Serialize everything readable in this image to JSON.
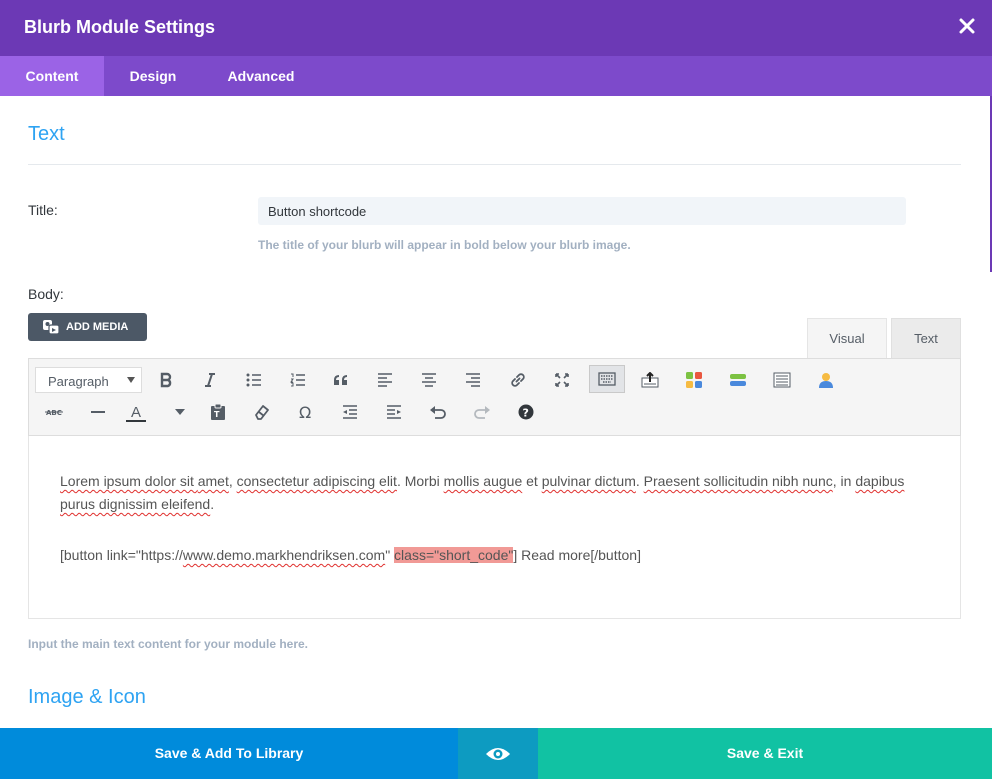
{
  "modal": {
    "title": "Blurb Module Settings"
  },
  "tabs": [
    {
      "label": "Content"
    },
    {
      "label": "Design"
    },
    {
      "label": "Advanced"
    }
  ],
  "sections": {
    "text": "Text",
    "image_icon": "Image & Icon"
  },
  "title_field": {
    "label": "Title:",
    "value": "Button shortcode",
    "help": "The title of your blurb will appear in bold below your blurb image."
  },
  "body_field": {
    "label": "Body:",
    "add_media": "ADD MEDIA",
    "tab_visual": "Visual",
    "tab_text": "Text",
    "format_select": "Paragraph",
    "help": "Input the main text content for your module here."
  },
  "editor_content": {
    "p1_a": "Lorem ipsum dolor sit ",
    "p1_b": "amet",
    "p1_c": ", ",
    "p1_d": "consectetur adipiscing elit",
    "p1_e": ". Morbi ",
    "p1_f": "mollis augue",
    "p1_g": " et ",
    "p1_h": "pulvinar dictum",
    "p1_i": ". ",
    "p1_j": "Praesent sollicitudin nibh nunc",
    "p1_k": ", in ",
    "p1_l": "dapibus purus dignissim eleifend",
    "p1_m": ".",
    "p2_a": "[button link=\"https://",
    "p2_b": "www.demo.markhendriksen.com",
    "p2_c": "\" ",
    "p2_d": "class=\"short_code\"",
    "p2_e": "] Read more[/button]"
  },
  "footer": {
    "save_library": "Save & Add To Library",
    "save_exit": "Save & Exit"
  },
  "colors": {
    "header": "#6c39b5",
    "tabbar": "#7d4acb",
    "active_tab": "#9b63e6",
    "accent_blue": "#2ea3f2",
    "save_library": "#008bdb",
    "preview": "#0d9bc1",
    "save_exit": "#11c2a3"
  }
}
